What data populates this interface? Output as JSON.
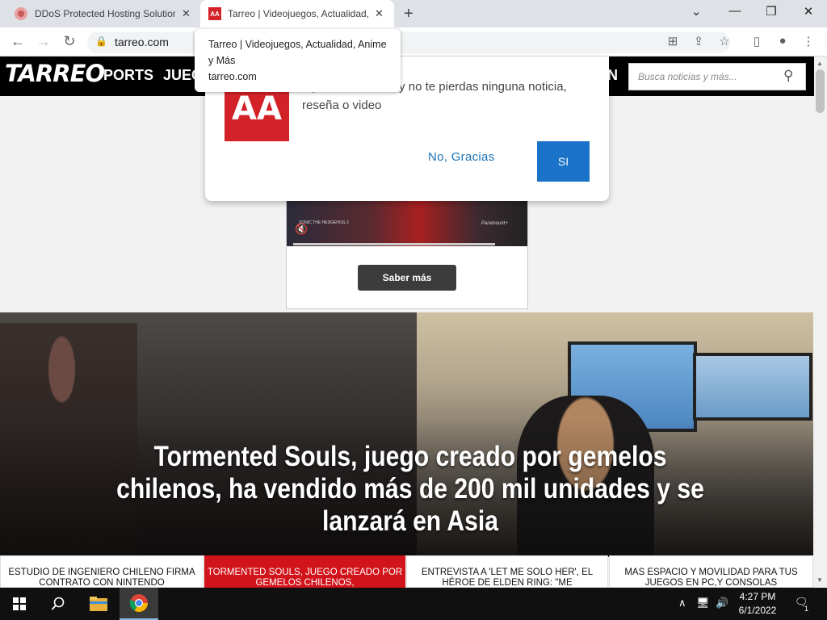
{
  "browser": {
    "tabs": [
      {
        "title": "DDoS Protected Hosting Solution",
        "active": false
      },
      {
        "title": "Tarreo | Videojuegos, Actualidad,",
        "active": true
      }
    ],
    "new_tab_icon": "+",
    "url": "tarreo.com",
    "tooltip": {
      "title": "Tarreo | Videojuegos, Actualidad, Anime y Más",
      "host": "tarreo.com"
    }
  },
  "site": {
    "logo": "TARREO",
    "menu": [
      "PORTS",
      "JUEG",
      "N"
    ],
    "search_placeholder": "Busca noticias y más..."
  },
  "notification": {
    "logo_text": "AA",
    "message": "...p notificaciones y no te pierdas ninguna noticia, reseña o video",
    "no_label": "No, Gracias",
    "yes_label": "SI"
  },
  "ad": {
    "small_text": "SONIC THE HEDGEHOG 2",
    "brand": "Paramount+",
    "button_label": "Saber más"
  },
  "hero": {
    "title": "Tormented Souls, juego creado por gemelos chilenos, ha vendido más de 200 mil unidades y se lanzará en Asia"
  },
  "cards": [
    {
      "text": "ESTUDIO DE INGENIERO CHILENO FIRMA CONTRATO CON NINTENDO",
      "active": false
    },
    {
      "text": "TORMENTED SOULS, JUEGO CREADO POR GEMELOS CHILENOS,",
      "active": true
    },
    {
      "text": "ENTREVISTA A 'LET ME SOLO HER', EL HÉROE DE ELDEN RING: \"ME",
      "active": false
    },
    {
      "text": "MAS ESPACIO Y MOVILIDAD PARA TUS JUEGOS EN PC,Y CONSOLAS",
      "active": false
    }
  ],
  "taskbar": {
    "time": "4:27 PM",
    "date": "6/1/2022",
    "notification_count": "1"
  },
  "colors": {
    "brand_red": "#d32128",
    "prompt_blue": "#1a73c8",
    "site_header": "#000000"
  }
}
